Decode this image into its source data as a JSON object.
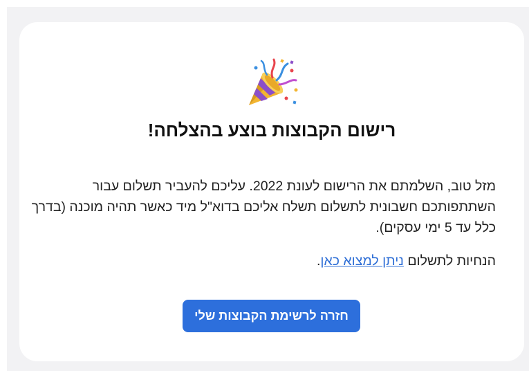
{
  "icon": "party-popper-icon",
  "title": "רישום הקבוצות בוצע בהצלחה!",
  "message": "מזל טוב, השלמתם את הרישום לעונת 2022. עליכם להעביר תשלום עבור השתתפותכם חשבונית לתשלום תשלח אליכם בדוא\"ל מיד כאשר תהיה מוכנה (בדרך כלל עד 5 ימי עסקים).",
  "payment": {
    "prefix": "הנחיות לתשלום",
    "link_text": "ניתן למצוא כאן",
    "suffix": "."
  },
  "button_label": "חזרה לרשימת הקבוצות שלי",
  "colors": {
    "accent": "#2d6fdc",
    "link": "#2f6fd6",
    "page_bg": "#f2f2f4",
    "card_bg": "#ffffff"
  }
}
